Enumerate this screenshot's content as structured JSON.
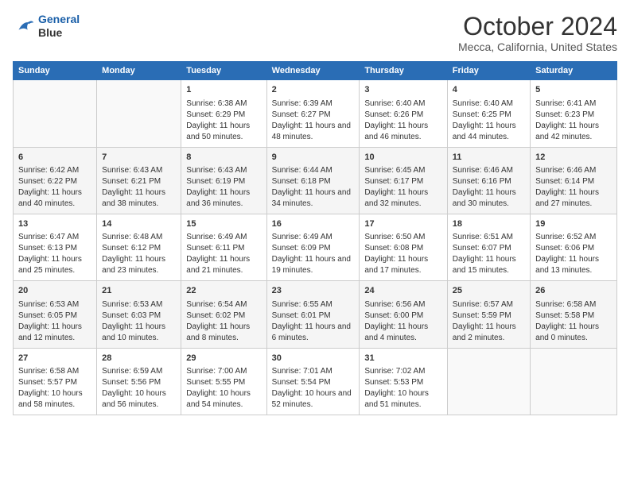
{
  "header": {
    "logo_line1": "General",
    "logo_line2": "Blue",
    "title": "October 2024",
    "subtitle": "Mecca, California, United States"
  },
  "days_of_week": [
    "Sunday",
    "Monday",
    "Tuesday",
    "Wednesday",
    "Thursday",
    "Friday",
    "Saturday"
  ],
  "weeks": [
    [
      {
        "day": "",
        "info": ""
      },
      {
        "day": "",
        "info": ""
      },
      {
        "day": "1",
        "info": "Sunrise: 6:38 AM\nSunset: 6:29 PM\nDaylight: 11 hours and 50 minutes."
      },
      {
        "day": "2",
        "info": "Sunrise: 6:39 AM\nSunset: 6:27 PM\nDaylight: 11 hours and 48 minutes."
      },
      {
        "day": "3",
        "info": "Sunrise: 6:40 AM\nSunset: 6:26 PM\nDaylight: 11 hours and 46 minutes."
      },
      {
        "day": "4",
        "info": "Sunrise: 6:40 AM\nSunset: 6:25 PM\nDaylight: 11 hours and 44 minutes."
      },
      {
        "day": "5",
        "info": "Sunrise: 6:41 AM\nSunset: 6:23 PM\nDaylight: 11 hours and 42 minutes."
      }
    ],
    [
      {
        "day": "6",
        "info": "Sunrise: 6:42 AM\nSunset: 6:22 PM\nDaylight: 11 hours and 40 minutes."
      },
      {
        "day": "7",
        "info": "Sunrise: 6:43 AM\nSunset: 6:21 PM\nDaylight: 11 hours and 38 minutes."
      },
      {
        "day": "8",
        "info": "Sunrise: 6:43 AM\nSunset: 6:19 PM\nDaylight: 11 hours and 36 minutes."
      },
      {
        "day": "9",
        "info": "Sunrise: 6:44 AM\nSunset: 6:18 PM\nDaylight: 11 hours and 34 minutes."
      },
      {
        "day": "10",
        "info": "Sunrise: 6:45 AM\nSunset: 6:17 PM\nDaylight: 11 hours and 32 minutes."
      },
      {
        "day": "11",
        "info": "Sunrise: 6:46 AM\nSunset: 6:16 PM\nDaylight: 11 hours and 30 minutes."
      },
      {
        "day": "12",
        "info": "Sunrise: 6:46 AM\nSunset: 6:14 PM\nDaylight: 11 hours and 27 minutes."
      }
    ],
    [
      {
        "day": "13",
        "info": "Sunrise: 6:47 AM\nSunset: 6:13 PM\nDaylight: 11 hours and 25 minutes."
      },
      {
        "day": "14",
        "info": "Sunrise: 6:48 AM\nSunset: 6:12 PM\nDaylight: 11 hours and 23 minutes."
      },
      {
        "day": "15",
        "info": "Sunrise: 6:49 AM\nSunset: 6:11 PM\nDaylight: 11 hours and 21 minutes."
      },
      {
        "day": "16",
        "info": "Sunrise: 6:49 AM\nSunset: 6:09 PM\nDaylight: 11 hours and 19 minutes."
      },
      {
        "day": "17",
        "info": "Sunrise: 6:50 AM\nSunset: 6:08 PM\nDaylight: 11 hours and 17 minutes."
      },
      {
        "day": "18",
        "info": "Sunrise: 6:51 AM\nSunset: 6:07 PM\nDaylight: 11 hours and 15 minutes."
      },
      {
        "day": "19",
        "info": "Sunrise: 6:52 AM\nSunset: 6:06 PM\nDaylight: 11 hours and 13 minutes."
      }
    ],
    [
      {
        "day": "20",
        "info": "Sunrise: 6:53 AM\nSunset: 6:05 PM\nDaylight: 11 hours and 12 minutes."
      },
      {
        "day": "21",
        "info": "Sunrise: 6:53 AM\nSunset: 6:03 PM\nDaylight: 11 hours and 10 minutes."
      },
      {
        "day": "22",
        "info": "Sunrise: 6:54 AM\nSunset: 6:02 PM\nDaylight: 11 hours and 8 minutes."
      },
      {
        "day": "23",
        "info": "Sunrise: 6:55 AM\nSunset: 6:01 PM\nDaylight: 11 hours and 6 minutes."
      },
      {
        "day": "24",
        "info": "Sunrise: 6:56 AM\nSunset: 6:00 PM\nDaylight: 11 hours and 4 minutes."
      },
      {
        "day": "25",
        "info": "Sunrise: 6:57 AM\nSunset: 5:59 PM\nDaylight: 11 hours and 2 minutes."
      },
      {
        "day": "26",
        "info": "Sunrise: 6:58 AM\nSunset: 5:58 PM\nDaylight: 11 hours and 0 minutes."
      }
    ],
    [
      {
        "day": "27",
        "info": "Sunrise: 6:58 AM\nSunset: 5:57 PM\nDaylight: 10 hours and 58 minutes."
      },
      {
        "day": "28",
        "info": "Sunrise: 6:59 AM\nSunset: 5:56 PM\nDaylight: 10 hours and 56 minutes."
      },
      {
        "day": "29",
        "info": "Sunrise: 7:00 AM\nSunset: 5:55 PM\nDaylight: 10 hours and 54 minutes."
      },
      {
        "day": "30",
        "info": "Sunrise: 7:01 AM\nSunset: 5:54 PM\nDaylight: 10 hours and 52 minutes."
      },
      {
        "day": "31",
        "info": "Sunrise: 7:02 AM\nSunset: 5:53 PM\nDaylight: 10 hours and 51 minutes."
      },
      {
        "day": "",
        "info": ""
      },
      {
        "day": "",
        "info": ""
      }
    ]
  ]
}
